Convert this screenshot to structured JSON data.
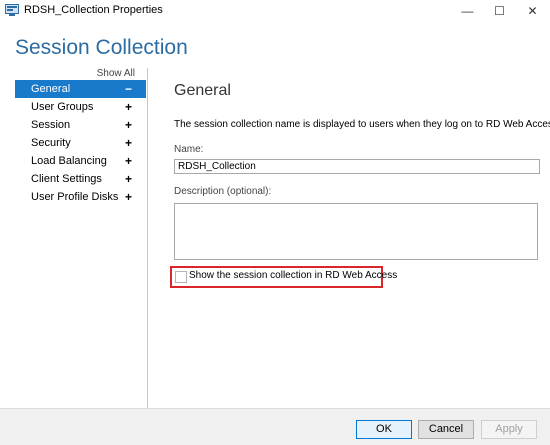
{
  "window": {
    "title": "RDSH_Collection Properties",
    "minimize_glyph": "—",
    "maximize_glyph": "☐",
    "close_glyph": "✕"
  },
  "header": {
    "title": "Session Collection"
  },
  "nav": {
    "show_all": "Show All",
    "items": [
      {
        "label": "General",
        "sign": "−",
        "selected": true
      },
      {
        "label": "User Groups",
        "sign": "+"
      },
      {
        "label": "Session",
        "sign": "+"
      },
      {
        "label": "Security",
        "sign": "+"
      },
      {
        "label": "Load Balancing",
        "sign": "+"
      },
      {
        "label": "Client Settings",
        "sign": "+"
      },
      {
        "label": "User Profile Disks",
        "sign": "+"
      }
    ]
  },
  "general": {
    "title": "General",
    "description": "The session collection name is displayed to users when they log on to RD Web Access.",
    "name_label": "Name:",
    "name_value": "RDSH_Collection",
    "description_label": "Description (optional):",
    "description_value": "",
    "show_in_web_access_label": "Show the session collection in RD Web Access",
    "show_in_web_access_checked": false
  },
  "footer": {
    "ok": "OK",
    "cancel": "Cancel",
    "apply": "Apply"
  },
  "colors": {
    "accent": "#1979ca",
    "title_blue": "#2d6ca2",
    "highlight_border": "#d9262b"
  }
}
